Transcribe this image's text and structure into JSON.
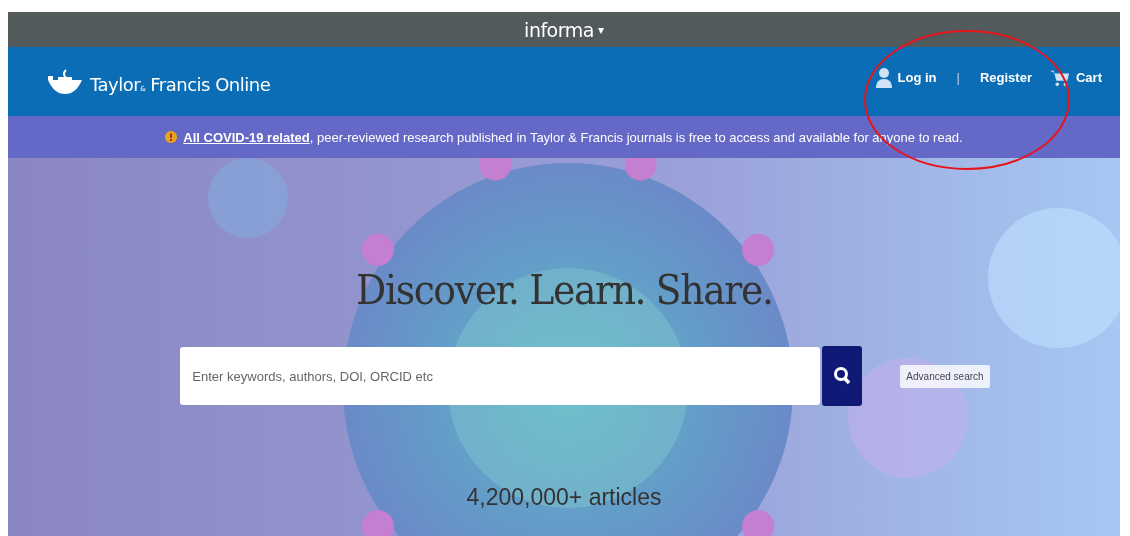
{
  "top_bar": {
    "brand": "informa",
    "caret": "▾"
  },
  "header": {
    "logo": "Taylor$_{&}$ Francis Online",
    "nav": [
      {
        "kind": "user",
        "label": "Log in"
      },
      {
        "kind": "divider",
        "label": "|"
      },
      {
        "kind": "plain",
        "label": "Register"
      },
      {
        "kind": "cart",
        "label": "Cart"
      }
    ]
  },
  "banner": {
    "link": "All COVID-19 related",
    "text": ", peer-reviewed research published in Taylor & Francis journals is free to access and available for anyone to read."
  },
  "hero": {
    "kind": "picture",
    "heading": "Discover. Learn. Share.",
    "search": {
      "placeholder": "Enter keywords, authors, DOI, ORCID etc"
    },
    "advanced": "Advanced search",
    "count": "4,200,000+ articles"
  },
  "annotation": {
    "kind": "ellipse",
    "color": "#e8141c"
  }
}
